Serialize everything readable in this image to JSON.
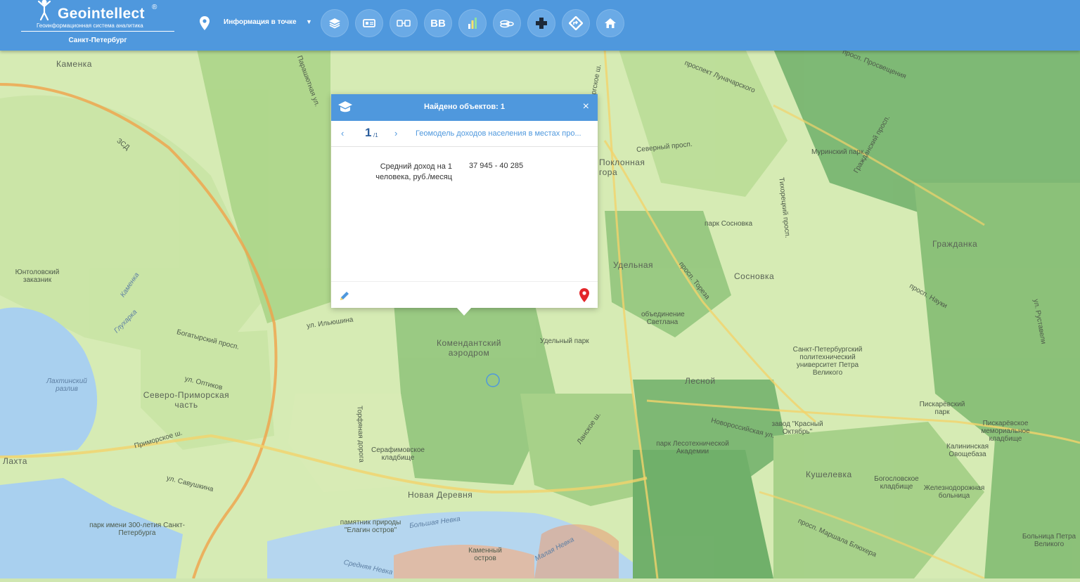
{
  "header": {
    "brand": "Geointellect",
    "trademark": "®",
    "tagline": "Геоинформационная система аналитика",
    "city": "Санкт-Петербург",
    "mode_label": "Информация в точке",
    "mode_caret": "▼",
    "toolbar": [
      {
        "name": "layers-button",
        "icon": "layers-icon",
        "glyph": ""
      },
      {
        "name": "catalog-button",
        "icon": "card-icon",
        "glyph": ""
      },
      {
        "name": "compare-button",
        "icon": "transfer-icon",
        "glyph": ""
      },
      {
        "name": "bb-button",
        "icon": "bb-text-icon",
        "glyph": "BB"
      },
      {
        "name": "analytics-button",
        "icon": "bar-chart-icon",
        "glyph": ""
      },
      {
        "name": "finance-button",
        "icon": "coins-icon",
        "glyph": ""
      },
      {
        "name": "medical-button",
        "icon": "medical-cross-icon",
        "glyph": ""
      },
      {
        "name": "route-button",
        "icon": "direction-icon",
        "glyph": ""
      },
      {
        "name": "home-button",
        "icon": "home-icon",
        "glyph": ""
      }
    ]
  },
  "popup": {
    "title": "Найдено объектов: 1",
    "close": "×",
    "prev": "‹",
    "next": "›",
    "current": "1",
    "of": "/1",
    "layer_name": "Геомодель доходов населения в местах про...",
    "field_label": "Средний доход на 1 человека, руб./месяц",
    "field_value": "37 945 - 40 285"
  },
  "map": {
    "colors": {
      "low": "#d9ecb6",
      "mid": "#a9d486",
      "high": "#6fb06a",
      "water": "#a9d0ef",
      "road": "#f2d36b",
      "hot": "#f0b08a"
    },
    "labels": [
      {
        "text": "Каменка",
        "kind": "big"
      },
      {
        "text": "Юнтоловский заказник",
        "kind": "small"
      },
      {
        "text": "Лахтинский разлив",
        "kind": "water"
      },
      {
        "text": "Северо-Приморская часть",
        "kind": "big"
      },
      {
        "text": "Лахта",
        "kind": "big"
      },
      {
        "text": "парк имени 300-летия Санкт-Петербурга",
        "kind": "small"
      },
      {
        "text": "Комендантский аэродром",
        "kind": "big"
      },
      {
        "text": "Удельный парк",
        "kind": "small"
      },
      {
        "text": "Серафимовское кладбище",
        "kind": "small"
      },
      {
        "text": "Новая Деревня",
        "kind": "big"
      },
      {
        "text": "памятник природы \"Елагин остров\"",
        "kind": "small"
      },
      {
        "text": "Каменный остров",
        "kind": "small"
      },
      {
        "text": "Удельная",
        "kind": "big"
      },
      {
        "text": "Сосновка",
        "kind": "big"
      },
      {
        "text": "парк Сосновка",
        "kind": "small"
      },
      {
        "text": "объединение Светлана",
        "kind": "small"
      },
      {
        "text": "Лесной",
        "kind": "big"
      },
      {
        "text": "парк Лесотехнической Академии",
        "kind": "small"
      },
      {
        "text": "Санкт-Петербургский политехнический университет Петра Великого",
        "kind": "small"
      },
      {
        "text": "Гражданка",
        "kind": "big"
      },
      {
        "text": "Муринский парк",
        "kind": "small"
      },
      {
        "text": "Пискарёвский парк",
        "kind": "small"
      },
      {
        "text": "Кушелевка",
        "kind": "big"
      },
      {
        "text": "Богословское кладбище",
        "kind": "small"
      },
      {
        "text": "Железнодорожная больница",
        "kind": "small"
      },
      {
        "text": "Больница Петра Великого",
        "kind": "small"
      },
      {
        "text": "Пискарёвское мемориальное кладбище",
        "kind": "small"
      },
      {
        "text": "Калининская Овощебаза",
        "kind": "small"
      },
      {
        "text": "завод \"Красный Октябрь\"",
        "kind": "small"
      },
      {
        "text": "Поклонная гора",
        "kind": "big"
      },
      {
        "text": "проспект Луначарского",
        "kind": "street"
      },
      {
        "text": "Северный просп.",
        "kind": "street"
      },
      {
        "text": "просп. Тореза",
        "kind": "street"
      },
      {
        "text": "Новороссийская ул.",
        "kind": "street"
      },
      {
        "text": "ул. Ильюшина",
        "kind": "street"
      },
      {
        "text": "Богатырский просп.",
        "kind": "street"
      },
      {
        "text": "ул. Оптиков",
        "kind": "street"
      },
      {
        "text": "Приморское ш.",
        "kind": "street"
      },
      {
        "text": "ул. Савушкина",
        "kind": "street"
      },
      {
        "text": "Большая Невка",
        "kind": "water"
      },
      {
        "text": "Средняя Невка",
        "kind": "water"
      },
      {
        "text": "Малая Невка",
        "kind": "water"
      },
      {
        "text": "Торфяная дорога",
        "kind": "street"
      },
      {
        "text": "ЗСД",
        "kind": "street"
      },
      {
        "text": "просп. Просвещения",
        "kind": "street"
      },
      {
        "text": "Гражданский просп.",
        "kind": "street"
      },
      {
        "text": "просп. Науки",
        "kind": "street"
      },
      {
        "text": "просп. Маршала Блюхера",
        "kind": "street"
      },
      {
        "text": "ул. Руставели",
        "kind": "street"
      },
      {
        "text": "Тихорецкий просп.",
        "kind": "street"
      },
      {
        "text": "Выборгское ш.",
        "kind": "street"
      },
      {
        "text": "Парашютная ул.",
        "kind": "street"
      },
      {
        "text": "Каменка",
        "kind": "water"
      },
      {
        "text": "Глухарка",
        "kind": "water"
      },
      {
        "text": "Ланское ш.",
        "kind": "street"
      }
    ]
  }
}
